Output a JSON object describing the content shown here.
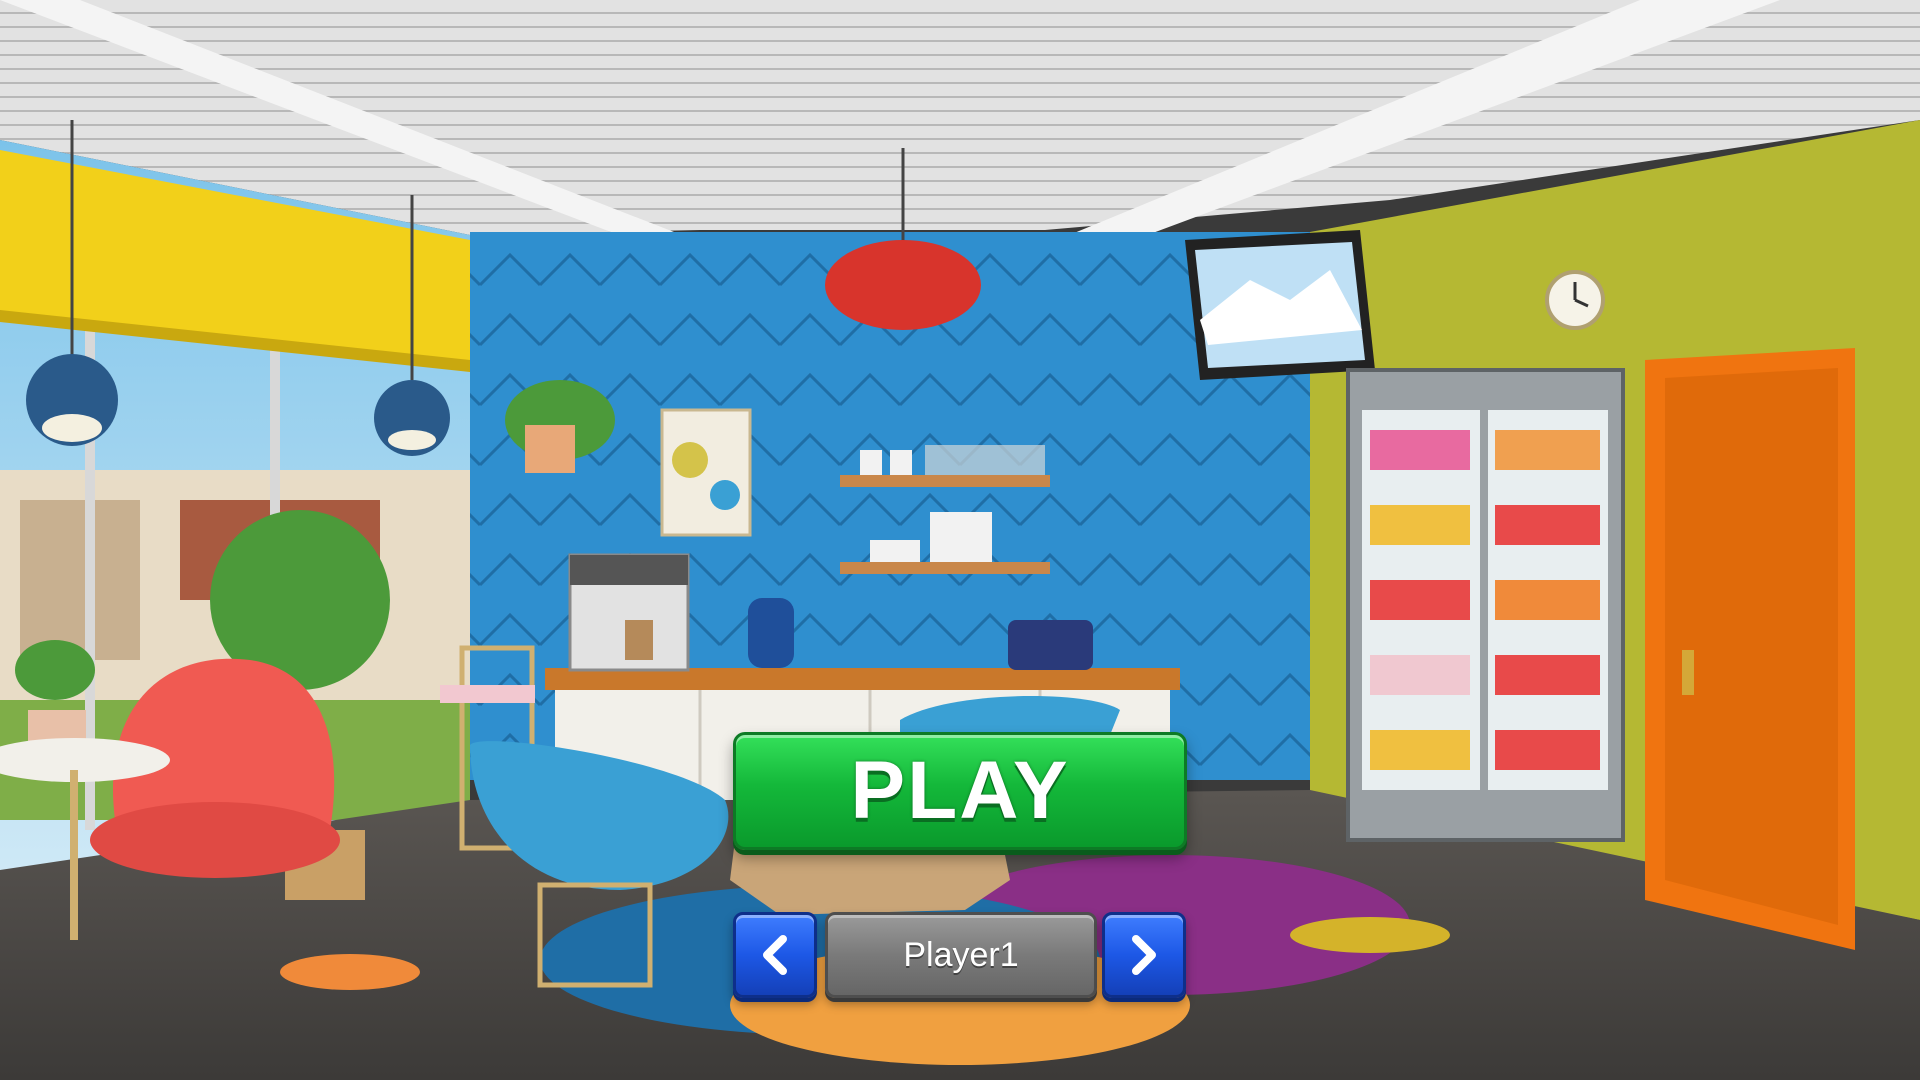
{
  "menu": {
    "play_label": "PLAY",
    "player_name": "Player1",
    "prev_icon": "chevron-left-icon",
    "next_icon": "chevron-right-icon"
  },
  "colors": {
    "play_green": "#14b83a",
    "arrow_blue": "#1d58e6",
    "player_gray": "#7a7a7a"
  }
}
